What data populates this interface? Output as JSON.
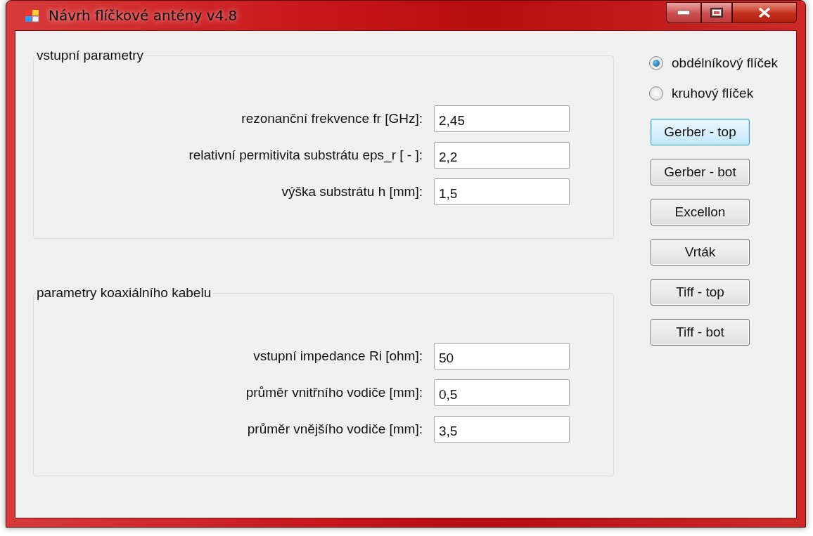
{
  "window": {
    "title": "Návrh flíčkové antény v4.8"
  },
  "groups": [
    {
      "title": "vstupní parametry",
      "fields": [
        {
          "label": "rezonanční frekvence fr [GHz]:",
          "value": "2,45"
        },
        {
          "label": "relativní permitivita substrátu eps_r [ - ]:",
          "value": "2,2"
        },
        {
          "label": "výška substrátu h [mm]:",
          "value": "1,5"
        }
      ]
    },
    {
      "title": "parametry koaxiálního kabelu",
      "fields": [
        {
          "label": "vstupní impedance Ri [ohm]:",
          "value": "50"
        },
        {
          "label": "průměr vnitřního vodiče [mm]:",
          "value": "0,5"
        },
        {
          "label": "průměr vnějšího vodiče [mm]:",
          "value": "3,5"
        }
      ]
    }
  ],
  "shape_options": [
    {
      "label": "obdélníkový flíček",
      "selected": true
    },
    {
      "label": "kruhový flíček",
      "selected": false
    }
  ],
  "buttons": [
    {
      "label": "Gerber - top",
      "focused": true
    },
    {
      "label": "Gerber - bot",
      "focused": false
    },
    {
      "label": "Excellon",
      "focused": false
    },
    {
      "label": "Vrták",
      "focused": false
    },
    {
      "label": "Tiff - top",
      "focused": false
    },
    {
      "label": "Tiff - bot",
      "focused": false
    }
  ]
}
